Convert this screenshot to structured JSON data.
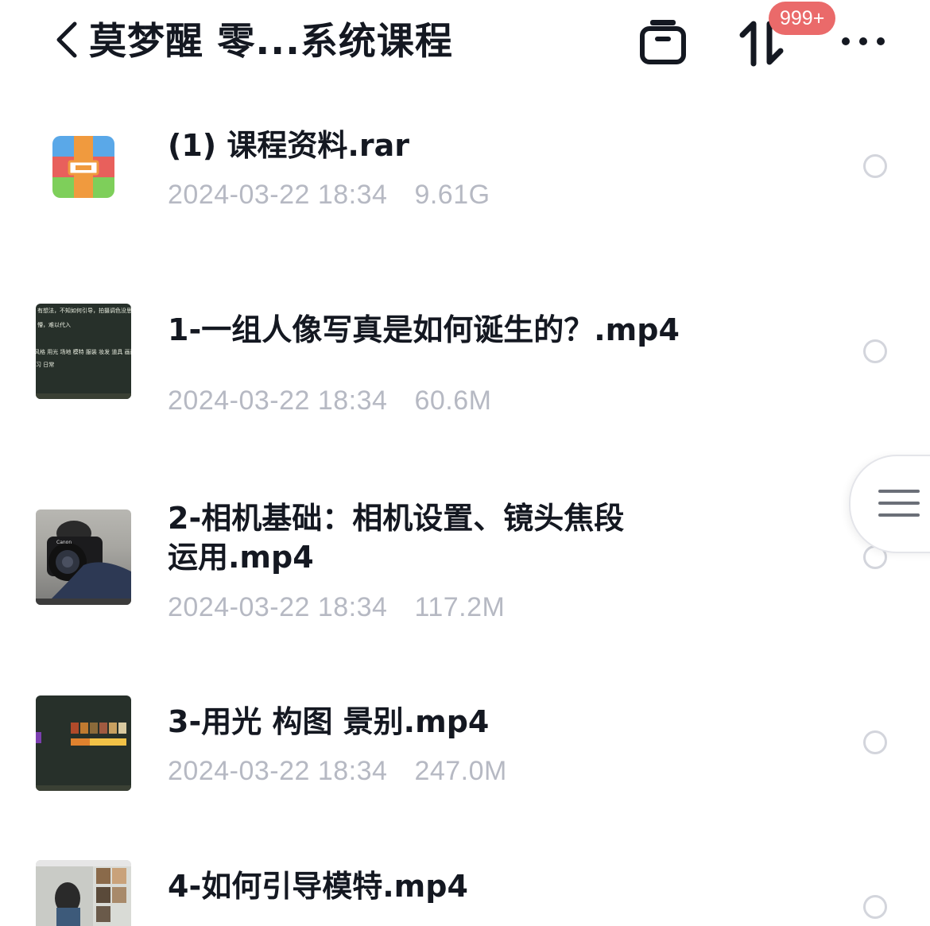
{
  "header": {
    "title": "莫梦醒 零...系统课程",
    "badge": "999+",
    "icons": [
      "back-chevron-icon",
      "transfer-list-icon",
      "sort-icon",
      "more-icon"
    ]
  },
  "files": [
    {
      "name": "(1) 课程资料.rar",
      "date": "2024-03-22 18:34",
      "size": "9.61G",
      "type": "archive"
    },
    {
      "name": "1-一组人像写真是如何诞生的？.mp4",
      "date": "2024-03-22 18:34",
      "size": "60.6M",
      "type": "video",
      "thumb_text": [
        "有想法，不知如何引导，拍摄调色没思路",
        "懵，难以代入",
        "风格 用光 场地 模特 服装 妆发 道具 画面组",
        "习 日常"
      ]
    },
    {
      "name_lines": [
        "2-相机基础：相机设置、镜头焦段",
        "运用.mp4"
      ],
      "date": "2024-03-22 18:34",
      "size": "117.2M",
      "type": "video",
      "thumb_text": [
        "Canon"
      ]
    },
    {
      "name": "3-用光 构图 景别.mp4",
      "date": "2024-03-22 18:34",
      "size": "247.0M",
      "type": "video"
    },
    {
      "name": "4-如何引导模特.mp4",
      "type": "video"
    }
  ]
}
